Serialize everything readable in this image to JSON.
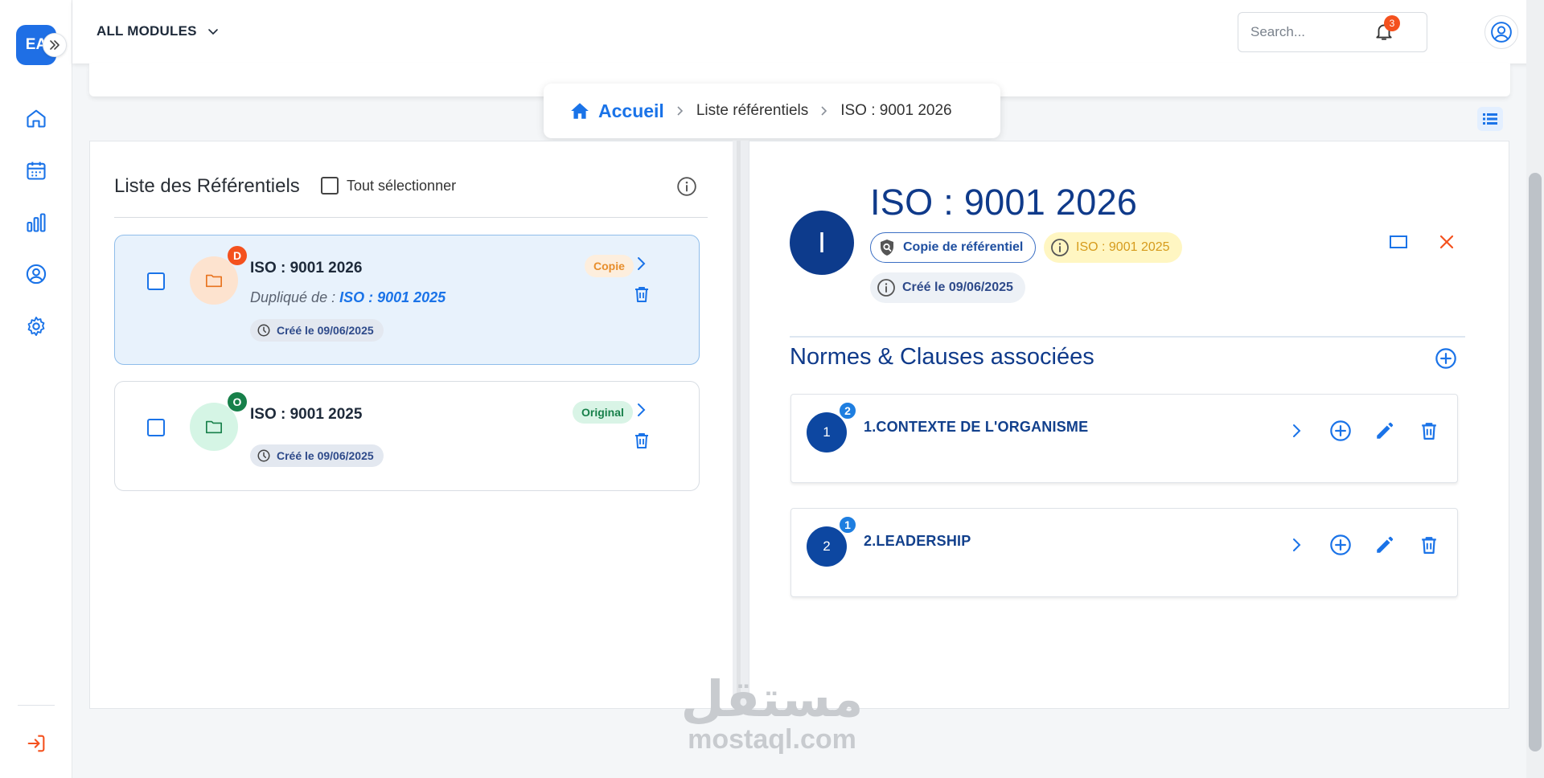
{
  "sidebar": {
    "logo_text": "EA",
    "nav": [
      "home-icon",
      "calendar-icon",
      "chart-icon",
      "user-circle-icon",
      "gear-icon"
    ],
    "logout_icon": "logout-icon"
  },
  "topbar": {
    "modules_label": "ALL MODULES",
    "search_placeholder": "Search...",
    "notification_count": "3"
  },
  "breadcrumb": {
    "home": "Accueil",
    "items": [
      "Liste référentiels",
      "ISO : 9001 2026"
    ]
  },
  "left_panel": {
    "title": "Liste des Référentiels",
    "select_all_label": "Tout sélectionner",
    "cards": [
      {
        "letter": "D",
        "name": "ISO : 9001 2026",
        "duplicated_prefix": "Dupliqué de : ",
        "duplicated_from": "ISO : 9001 2025",
        "created": "Créé le 09/06/2025",
        "tag": "Copie"
      },
      {
        "letter": "O",
        "name": "ISO : 9001 2025",
        "created": "Créé le 09/06/2025",
        "tag": "Original"
      }
    ]
  },
  "right_panel": {
    "avatar_letter": "I",
    "title": "ISO : 9001 2026",
    "chip_copy": "Copie de référentiel",
    "chip_source": "ISO : 9001 2025",
    "chip_created": "Créé le 09/06/2025",
    "section_title": "Normes & Clauses associées",
    "clauses": [
      {
        "number": "1",
        "count": "2",
        "label": "1.CONTEXTE DE L'ORGANISME"
      },
      {
        "number": "2",
        "count": "1",
        "label": "2.LEADERSHIP"
      }
    ]
  },
  "colors": {
    "primary": "#1a73e8",
    "navy": "#0d47a1",
    "danger": "#f4511e",
    "copy_orange": "#e78e2c",
    "original_green": "#17804a"
  },
  "watermark": {
    "arabic": "مستقل",
    "latin": "mostaql.com"
  }
}
